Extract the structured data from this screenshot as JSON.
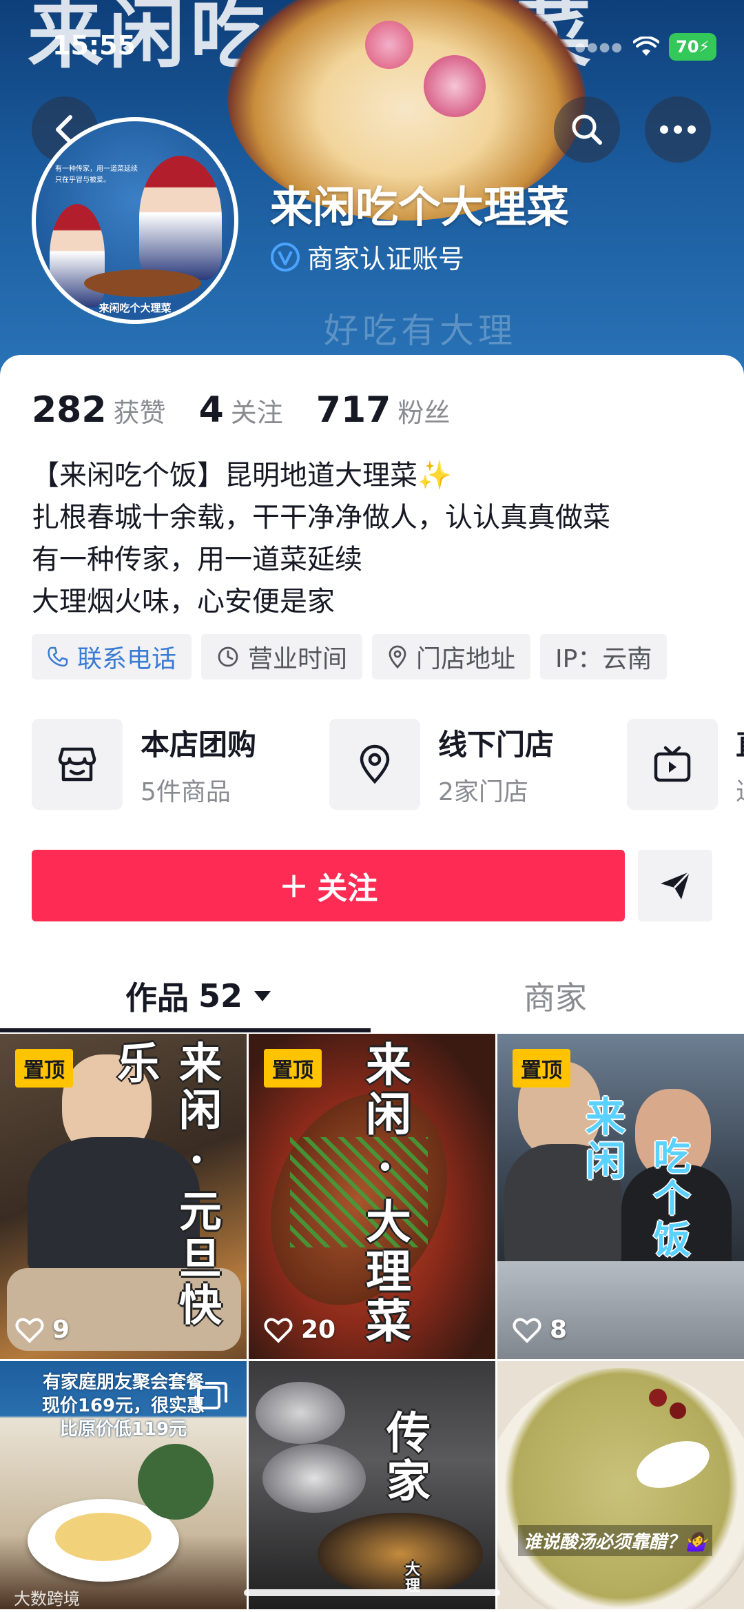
{
  "status_bar": {
    "time": "15:55",
    "battery": "70"
  },
  "banner": {
    "bg_title": "来闲吃个大理菜",
    "bg_sub": "好吃有大理"
  },
  "profile": {
    "name": "来闲吃个大理菜",
    "verified_label": "商家认证账号",
    "avatar_caption": "来闲吃个大理菜",
    "avatar_tiny": [
      "有一种传家，用一道菜延续",
      "只在乎冒与被爱。"
    ]
  },
  "stats": [
    {
      "value": "282",
      "label": "获赞"
    },
    {
      "value": "4",
      "label": "关注"
    },
    {
      "value": "717",
      "label": "粉丝"
    }
  ],
  "bio": [
    "【来闲吃个饭】昆明地道大理菜✨",
    "扎根春城十余载，干干净净做人，认认真真做菜",
    "有一种传家，用一道菜延续",
    "大理烟火味，心安便是家"
  ],
  "chips": {
    "phone": "联系电话",
    "hours": "营业时间",
    "address": "门店地址",
    "ip": "IP：云南"
  },
  "services": [
    {
      "title": "本店团购",
      "sub": "5件商品",
      "icon": "bag-icon"
    },
    {
      "title": "线下门店",
      "sub": "2家门店",
      "icon": "location-icon"
    },
    {
      "title": "直",
      "sub": "近",
      "icon": "tv-icon"
    }
  ],
  "actions": {
    "follow": "关注",
    "follow_prefix": "+"
  },
  "tabs": {
    "works_label": "作品",
    "works_count": "52",
    "merchant_label": "商家"
  },
  "grid": {
    "pin_label": "置顶",
    "tiles": [
      {
        "likes": "9",
        "overlay": "来闲·元旦快乐"
      },
      {
        "likes": "20",
        "overlay": "来闲·大理菜"
      },
      {
        "likes": "8",
        "overlay_a": "来闲",
        "overlay_b": "吃个饭"
      },
      {
        "promo": [
          "有家庭朋友聚会套餐",
          "现价169元，很实惠",
          "比原价低119元"
        ]
      },
      {
        "overlay": "传家",
        "overlay_small": "大理"
      },
      {
        "caption": "谁说酸汤必须靠醋？🤷‍♀️"
      }
    ]
  },
  "watermark": "大数跨境",
  "colors": {
    "accent": "#fe2c55",
    "pin": "#ffc300",
    "link": "#3a7bd5",
    "verified": "#4aa3ff"
  }
}
